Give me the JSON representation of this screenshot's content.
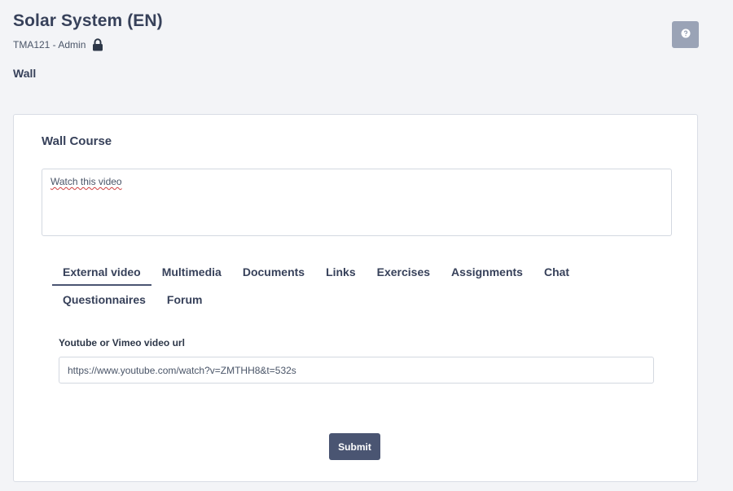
{
  "header": {
    "title": "Solar System (EN)",
    "meta": "TMA121 - Admin",
    "lock_icon": "lock-icon",
    "help_icon": "question-circle-icon",
    "section": "Wall"
  },
  "wall": {
    "title": "Wall Course",
    "message": "Watch this video",
    "tabs": [
      {
        "label": "External video",
        "active": true
      },
      {
        "label": "Multimedia"
      },
      {
        "label": "Documents"
      },
      {
        "label": "Links"
      },
      {
        "label": "Exercises"
      },
      {
        "label": "Assignments"
      },
      {
        "label": "Chat"
      },
      {
        "label": "Questionnaires"
      },
      {
        "label": "Forum"
      }
    ],
    "video": {
      "label": "Youtube or Vimeo video url",
      "value": "https://www.youtube.com/watch?v=ZMTHH8&t=532s"
    },
    "submit_label": "Submit"
  },
  "colors": {
    "primary": "#4a5572",
    "help_button": "#9aa3b6",
    "text": "#37415a"
  }
}
